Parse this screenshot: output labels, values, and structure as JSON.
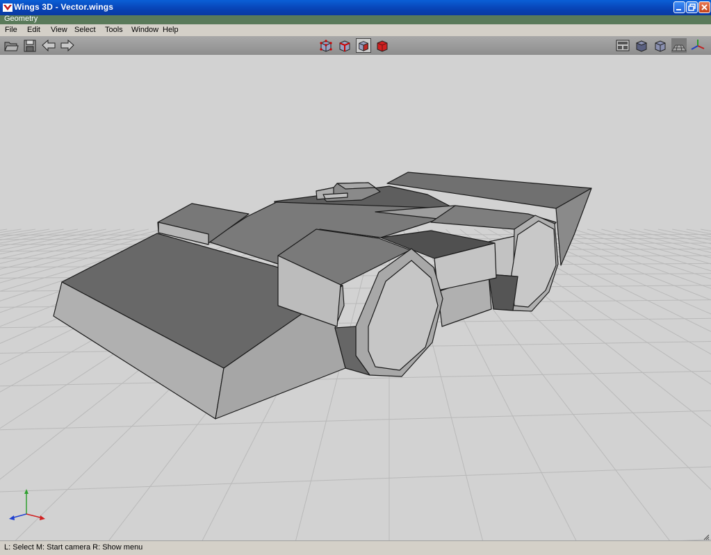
{
  "window": {
    "title": "Wings 3D - Vector.wings"
  },
  "geometry_tab": {
    "label": "Geometry"
  },
  "menu": {
    "items": [
      "File",
      "Edit",
      "View",
      "Select",
      "Tools",
      "Window",
      "Help"
    ]
  },
  "toolbar": {
    "left_icons": [
      "open-file-icon",
      "save-file-icon",
      "undo-arrow-icon",
      "redo-arrow-icon"
    ],
    "selection_modes": [
      "vertex-mode",
      "edge-mode",
      "face-mode",
      "body-mode"
    ],
    "active_selection_mode": "face-mode",
    "right_icons": [
      "workmode-icon",
      "smooth-shade-icon",
      "wireframe-shade-icon",
      "ground-grid-icon",
      "axes-icon"
    ]
  },
  "status": {
    "text": "L: Select   M: Start camera   R: Show menu"
  },
  "colors": {
    "viewport_bg": "#d2d2d2",
    "grid_line": "#b6b6b6",
    "model_outline": "#1a1a1a",
    "selection_active": "#cc2020"
  }
}
